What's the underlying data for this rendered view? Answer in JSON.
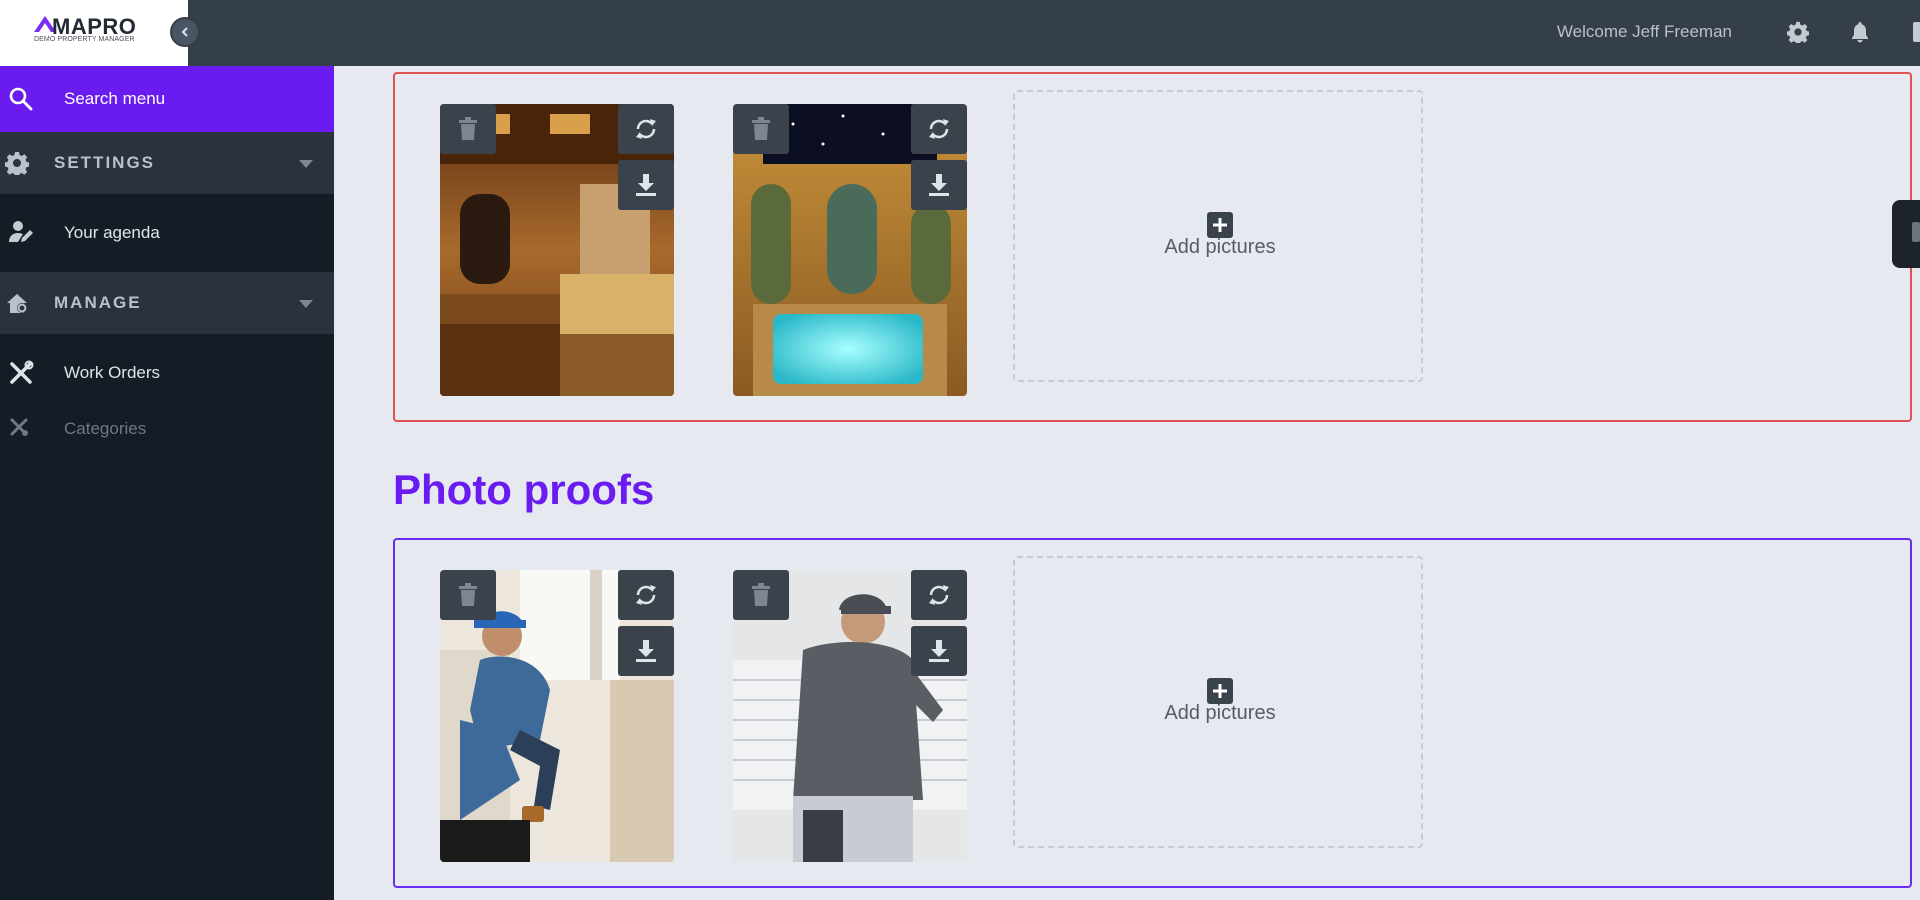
{
  "brand": {
    "name": "MAPRO",
    "subtitle": "DEMO PROPERTY MANAGER",
    "accent": "#6a1cf0"
  },
  "topbar": {
    "welcome": "Welcome Jeff Freeman",
    "icons": [
      "gear-icon",
      "bell-icon"
    ]
  },
  "sidebar": {
    "search_label": "Search menu",
    "sections": [
      {
        "label": "SETTINGS",
        "icon": "gear-icon"
      },
      {
        "label": "MANAGE",
        "icon": "house-gear-icon"
      }
    ],
    "items": [
      {
        "label": "Your agenda",
        "icon": "user-edit-icon"
      },
      {
        "label": "Work Orders",
        "icon": "tools-icon"
      },
      {
        "label": "Categories",
        "icon": "tools-small-icon"
      }
    ]
  },
  "main": {
    "pictures_panel": {
      "border_color": "#e05252",
      "add_label": "Add pictures"
    },
    "photo_proofs": {
      "title": "Photo proofs",
      "border_color": "#6a2cf0",
      "add_label": "Add pictures"
    }
  }
}
